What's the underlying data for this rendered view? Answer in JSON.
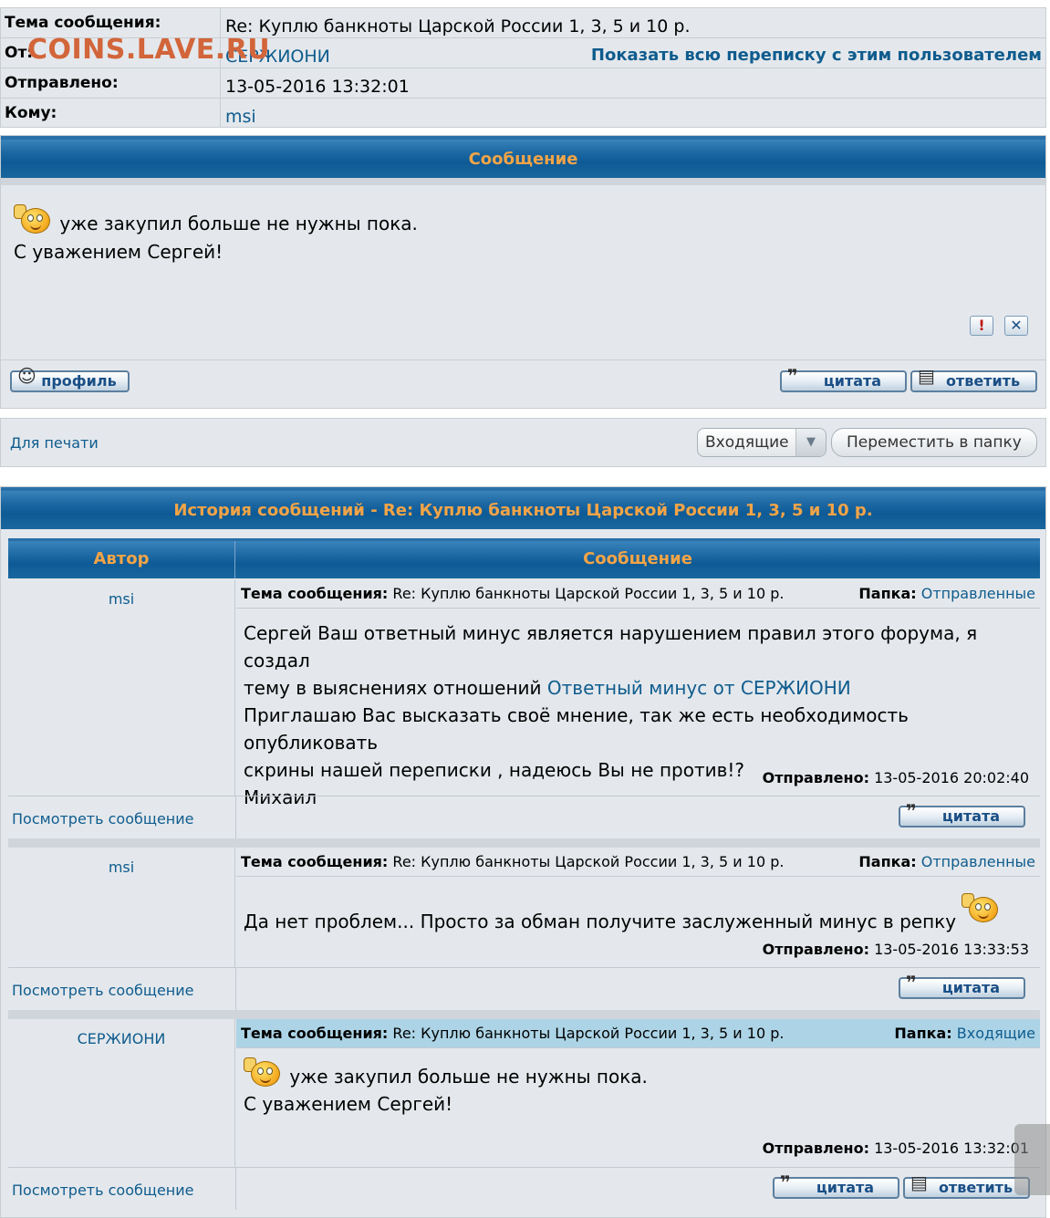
{
  "header": {
    "subject_label": "Тема сообщения:",
    "subject_value": "Re: Куплю банкноты Царской России 1, 3, 5 и 10 р.",
    "from_label": "От:",
    "from_value": "СЕРЖИОНИ",
    "show_all_link": "Показать всю переписку с этим пользователем",
    "sent_label": "Отправлено:",
    "sent_value": "13-05-2016 13:32:01",
    "to_label": "Кому:",
    "to_value": "msi",
    "watermark": "COINS.LAVE.RU"
  },
  "message": {
    "title": "Сообщение",
    "line1": "уже закупил больше не нужны пока.",
    "line2": "С уважением Сергей!",
    "report_icon_glyph": "!",
    "delete_icon_glyph": "✕",
    "profile_button": "профиль",
    "quote_button": "цитата",
    "reply_button": "ответить"
  },
  "tools": {
    "print_link": "Для печати",
    "folder_select": "Входящие",
    "move_button": "Переместить в папку"
  },
  "history": {
    "title": "История сообщений - Re: Куплю банкноты Царской России 1, 3, 5 и 10 р.",
    "col_author": "Автор",
    "col_message": "Сообщение",
    "subject_label": "Тема сообщения:",
    "folder_label": "Папка:",
    "sent_label": "Отправлено:",
    "view_link": "Посмотреть сообщение",
    "quote_button": "цитата",
    "reply_button": "ответить",
    "entries": [
      {
        "author": "msi",
        "subject": "Re: Куплю банкноты Царской России 1, 3, 5 и 10 р.",
        "folder": "Отправленные",
        "line1": "Сергей Ваш ответный минус является нарушением правил этого форума, я создал",
        "line2_text": "тему в выяснениях отношений",
        "line2_link": "Ответный минус от СЕРЖИОНИ",
        "line3": "Приглашаю Вас высказать своё мнение, так же есть необходимость опубликовать",
        "line4": "скрины нашей переписки , надеюсь Вы не против!?",
        "line5": "Михаил",
        "sent": "13-05-2016 20:02:40"
      },
      {
        "author": "msi",
        "subject": "Re: Куплю банкноты Царской России 1, 3, 5 и 10 р.",
        "folder": "Отправленные",
        "line1": "Да нет проблем... Просто за обман получите заслуженный минус в репку",
        "sent": "13-05-2016 13:33:53"
      },
      {
        "author": "СЕРЖИОНИ",
        "subject": "Re: Куплю банкноты Царской России 1, 3, 5 и 10 р.",
        "folder": "Входящие",
        "line1": "уже закупил больше не нужны пока.",
        "line2": "С уважением Сергей!",
        "sent": "13-05-2016 13:32:01"
      }
    ]
  },
  "colors": {
    "bar_blue": "#0d5a96",
    "bar_text": "#f2a447",
    "link": "#0f5c8e",
    "panel": "#e4e8ec",
    "highlight_row": "#acd4e6"
  }
}
